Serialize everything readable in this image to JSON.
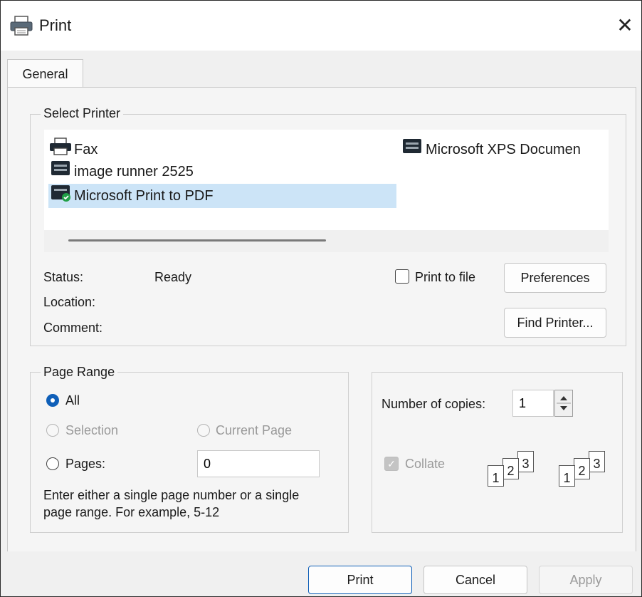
{
  "window": {
    "title": "Print",
    "close_glyph": "✕"
  },
  "tabs": [
    {
      "label": "General",
      "active": true
    }
  ],
  "select_printer": {
    "legend": "Select Printer",
    "printers": [
      {
        "name": "Fax",
        "icon": "fax-printer-icon",
        "selected": false
      },
      {
        "name": "image runner 2525",
        "icon": "printer-icon",
        "selected": false
      },
      {
        "name": "Microsoft Print to PDF",
        "icon": "default-printer-icon",
        "selected": true
      },
      {
        "name": "Microsoft XPS Documen",
        "icon": "printer-icon",
        "selected": false
      }
    ],
    "status_label": "Status:",
    "status_value": "Ready",
    "location_label": "Location:",
    "comment_label": "Comment:",
    "print_to_file_label": "Print to file",
    "print_to_file_checked": false,
    "preferences_label": "Preferences",
    "find_printer_label": "Find Printer..."
  },
  "page_range": {
    "legend": "Page Range",
    "all_label": "All",
    "selection_label": "Selection",
    "current_page_label": "Current Page",
    "pages_label": "Pages:",
    "pages_value": "0",
    "selected_option": "All",
    "hint_line1": "Enter either a single page number or a single",
    "hint_line2": "page range.  For example, 5-12"
  },
  "copies": {
    "label": "Number of copies:",
    "value": "1",
    "collate_label": "Collate",
    "collate_checked": true,
    "collate_disabled": true,
    "collate_pages": [
      "1",
      "2",
      "3"
    ]
  },
  "footer": {
    "print_label": "Print",
    "cancel_label": "Cancel",
    "apply_label": "Apply"
  },
  "colors": {
    "accent": "#0f5fb8",
    "selection": "#cce4f7",
    "dialog_bg": "#f0f0f0"
  }
}
